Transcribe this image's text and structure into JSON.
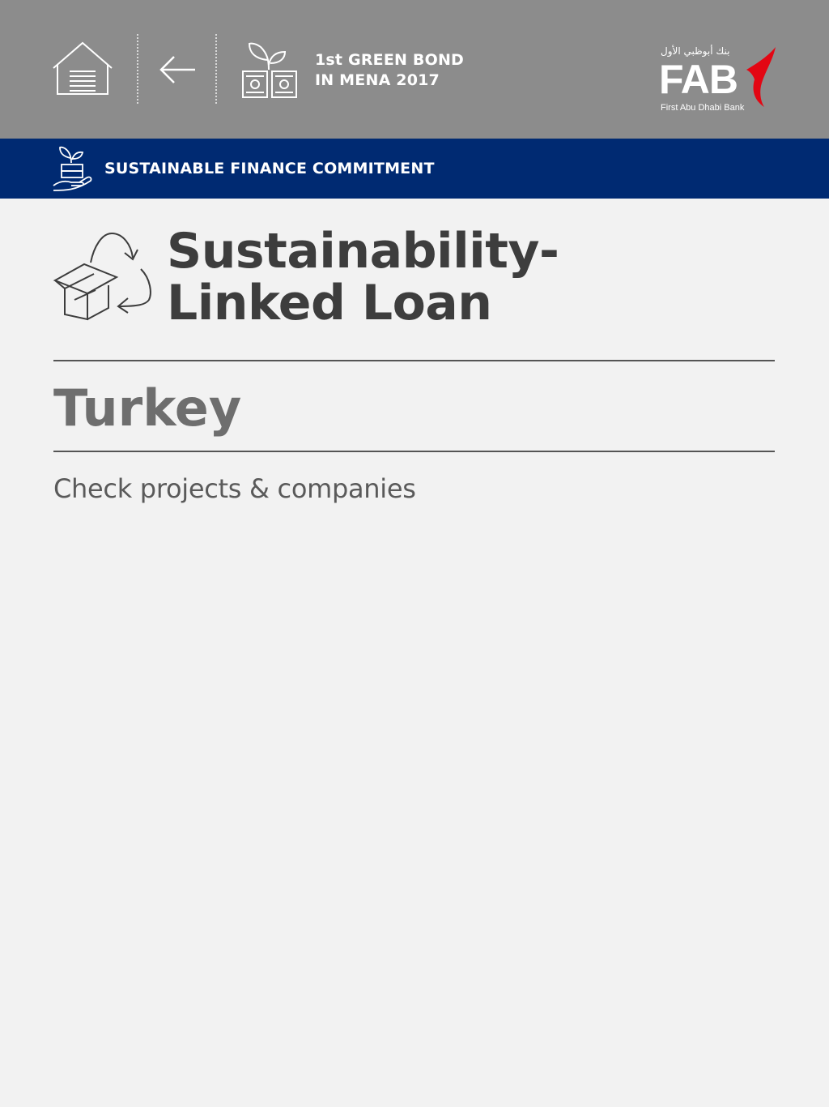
{
  "header": {
    "home_icon": "home-icon",
    "back_icon": "back-arrow-icon",
    "bond_icon": "plant-money-icon",
    "bond_line1": "1st GREEN BOND",
    "bond_line2": "IN MENA 2017",
    "logo": {
      "arabic_text": "بنك أبوظبي الأول",
      "wordmark": "FAB",
      "english_text": "First Abu Dhabi Bank",
      "accent_color": "#e30613"
    }
  },
  "section": {
    "icon": "hand-plant-icon",
    "title": "SUSTAINABLE FINANCE COMMITMENT"
  },
  "main": {
    "icon": "recycle-box-icon",
    "title_line1": "Sustainability-",
    "title_line2": "Linked Loan",
    "country": "Turkey",
    "link_text": "Check projects & companies"
  },
  "colors": {
    "header_bg": "#8c8c8c",
    "section_bg": "#002a72",
    "page_bg": "#f2f2f2"
  }
}
